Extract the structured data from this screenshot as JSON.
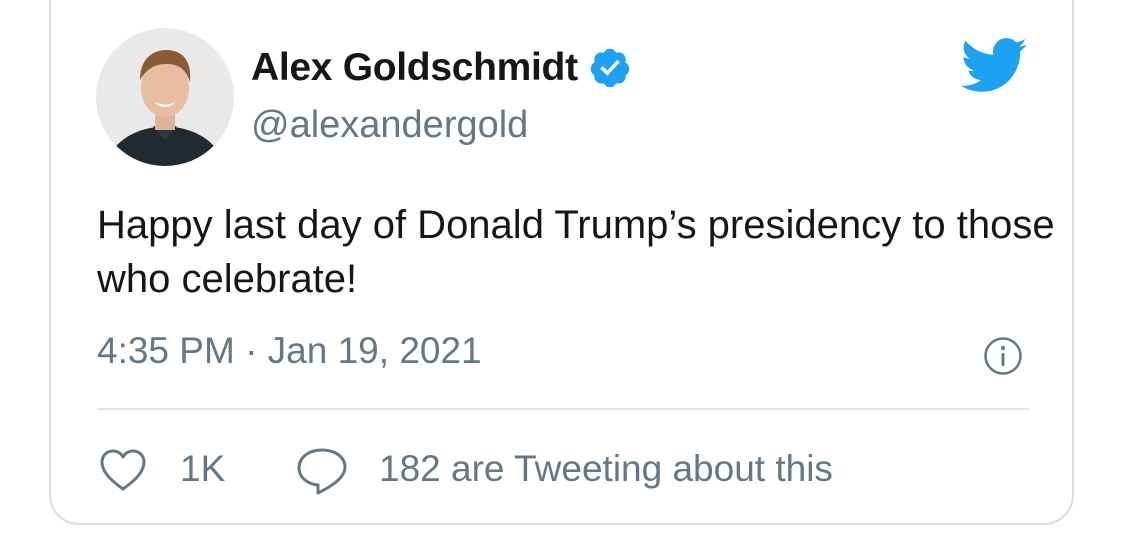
{
  "author": {
    "display_name": "Alex Goldschmidt",
    "handle": "@alexandergold",
    "verified": true,
    "avatar_icon": "user-avatar"
  },
  "tweet": {
    "text": "Happy last day of Donald Trump’s presidency to those who celebrate!",
    "timestamp": "4:35 PM · Jan 19, 2021"
  },
  "engagement": {
    "like_count": "1K",
    "tweeting_text": "182 are Tweeting about this"
  },
  "icons": {
    "brand": "twitter-bird-icon",
    "verified": "verified-badge-icon",
    "info": "info-icon",
    "like": "heart-icon",
    "reply": "speech-bubble-icon"
  },
  "colors": {
    "brand_blue": "#1da1f2",
    "text_primary": "#14171a",
    "text_secondary": "#657786",
    "border": "#d9dee3"
  }
}
